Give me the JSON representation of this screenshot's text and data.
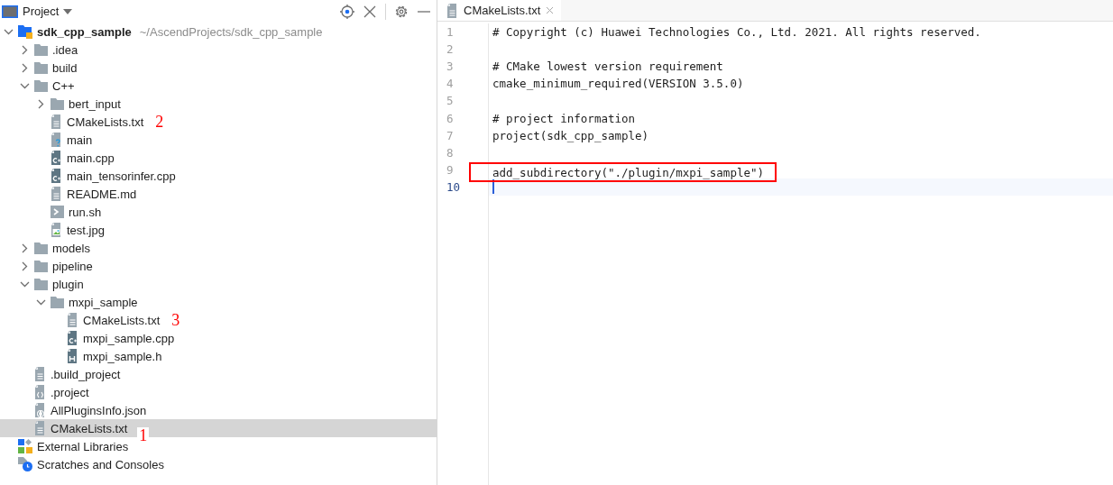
{
  "project_panel": {
    "title": "Project",
    "tree": [
      {
        "label": "sdk_cpp_sample",
        "path": "~/AscendProjects/sdk_cpp_sample",
        "kind": "project",
        "expanded": true,
        "selected": false,
        "children": [
          {
            "label": ".idea",
            "kind": "folder",
            "expanded": false,
            "selected": false
          },
          {
            "label": "build",
            "kind": "folder",
            "expanded": false,
            "selected": false
          },
          {
            "label": "C++",
            "kind": "folder",
            "expanded": true,
            "selected": false,
            "children": [
              {
                "label": "bert_input",
                "kind": "folder",
                "expanded": false,
                "selected": false
              },
              {
                "label": "CMakeLists.txt",
                "kind": "text",
                "selected": false,
                "annotation": "2"
              },
              {
                "label": "main",
                "kind": "unknown",
                "selected": false
              },
              {
                "label": "main.cpp",
                "kind": "cpp",
                "selected": false
              },
              {
                "label": "main_tensorinfer.cpp",
                "kind": "cpp",
                "selected": false
              },
              {
                "label": "README.md",
                "kind": "text",
                "selected": false
              },
              {
                "label": "run.sh",
                "kind": "shell",
                "selected": false
              },
              {
                "label": "test.jpg",
                "kind": "image",
                "selected": false
              }
            ]
          },
          {
            "label": "models",
            "kind": "folder",
            "expanded": false,
            "selected": false
          },
          {
            "label": "pipeline",
            "kind": "folder",
            "expanded": false,
            "selected": false
          },
          {
            "label": "plugin",
            "kind": "folder",
            "expanded": true,
            "selected": false,
            "children": [
              {
                "label": "mxpi_sample",
                "kind": "folder",
                "expanded": true,
                "selected": false,
                "children": [
                  {
                    "label": "CMakeLists.txt",
                    "kind": "text",
                    "selected": false,
                    "annotation": "3"
                  },
                  {
                    "label": "mxpi_sample.cpp",
                    "kind": "cpp",
                    "selected": false
                  },
                  {
                    "label": "mxpi_sample.h",
                    "kind": "header",
                    "selected": false
                  }
                ]
              }
            ]
          },
          {
            "label": ".build_project",
            "kind": "text",
            "selected": false
          },
          {
            "label": ".project",
            "kind": "xml",
            "selected": false
          },
          {
            "label": "AllPluginsInfo.json",
            "kind": "json",
            "selected": false
          },
          {
            "label": "CMakeLists.txt",
            "kind": "text",
            "selected": true,
            "annotation": "1"
          }
        ]
      },
      {
        "label": "External Libraries",
        "kind": "libraries",
        "selected": false
      },
      {
        "label": "Scratches and Consoles",
        "kind": "scratches",
        "selected": false
      }
    ]
  },
  "editor": {
    "tabs": [
      {
        "label": "CMakeLists.txt",
        "selected": true
      }
    ],
    "lines": [
      {
        "number": "1",
        "code": "# Copyright (c) Huawei Technologies Co., Ltd. 2021. All rights reserved.",
        "current": false,
        "boxed": false
      },
      {
        "number": "2",
        "current": false,
        "boxed": false
      },
      {
        "number": "3",
        "code": "# CMake lowest version requirement",
        "current": false,
        "boxed": false
      },
      {
        "number": "4",
        "code": "cmake_minimum_required(VERSION 3.5.0)",
        "current": false,
        "boxed": false
      },
      {
        "number": "5",
        "current": false,
        "boxed": false
      },
      {
        "number": "6",
        "code": "# project information",
        "current": false,
        "boxed": false
      },
      {
        "number": "7",
        "code": "project(sdk_cpp_sample)",
        "current": false,
        "boxed": false
      },
      {
        "number": "8",
        "current": false,
        "boxed": false
      },
      {
        "number": "9",
        "code": "add_subdirectory(\"./plugin/mxpi_sample\")",
        "current": false,
        "boxed": true
      },
      {
        "number": "10",
        "current": true,
        "boxed": false
      }
    ]
  }
}
